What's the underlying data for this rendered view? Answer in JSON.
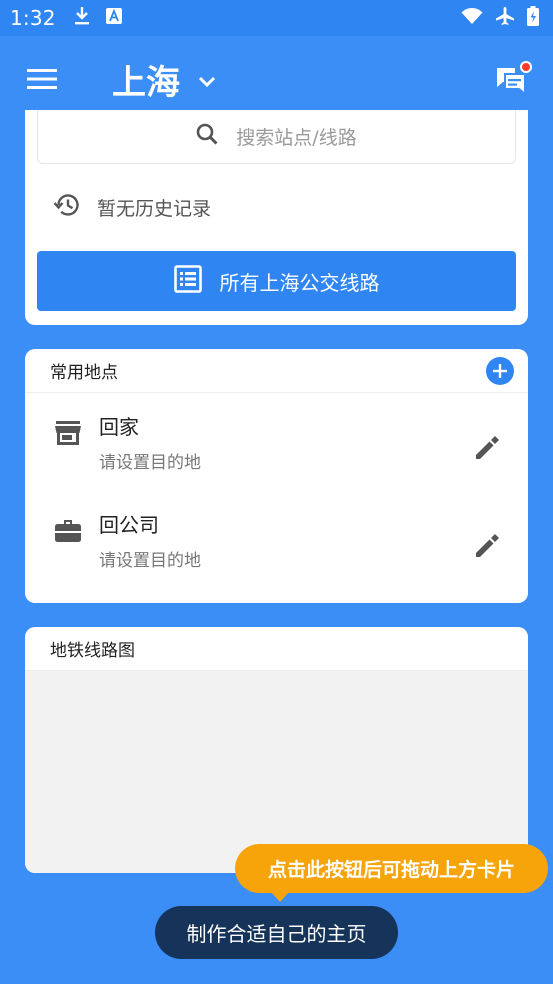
{
  "status_bar": {
    "time": "1:32",
    "icons_left": [
      "download-icon",
      "a-text-icon"
    ],
    "icons_right": [
      "wifi-icon",
      "airplane-icon",
      "battery-charging-icon"
    ]
  },
  "app_bar": {
    "city": "上海",
    "menu_icon": "menu-icon",
    "city_dropdown_icon": "chevron-down-icon",
    "messages_icon": "chat-icon",
    "has_notification_dot": true
  },
  "search": {
    "placeholder": "搜索站点/线路",
    "history_empty": "暂无历史记录",
    "all_lines_button": "所有上海公交线路"
  },
  "places": {
    "title": "常用地点",
    "items": [
      {
        "name": "回家",
        "subtitle": "请设置目的地",
        "icon": "store-icon"
      },
      {
        "name": "回公司",
        "subtitle": "请设置目的地",
        "icon": "briefcase-icon"
      }
    ]
  },
  "metro": {
    "title": "地铁线路图"
  },
  "tips": {
    "drag_hint": "点击此按钮后可拖动上方卡片",
    "customize": "制作合适自己的主页"
  },
  "colors": {
    "primary": "#3a8ef6",
    "button": "#2f86f3",
    "tip_orange": "#f7a40a",
    "tip_dark": "#16335a",
    "notification": "#ff3b30"
  }
}
